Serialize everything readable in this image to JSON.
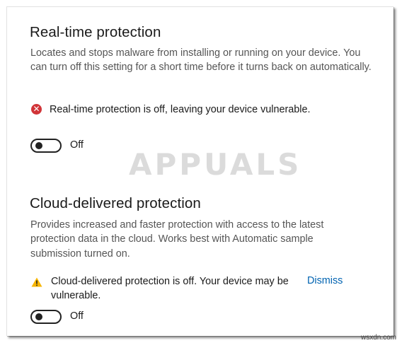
{
  "realtime": {
    "title": "Real-time protection",
    "description": "Locates and stops malware from installing or running on your device. You can turn off this setting for a short time before it turns back on automatically.",
    "status_text": "Real-time protection is off, leaving your device vulnerable.",
    "status_icon": "error-icon",
    "toggle_state": "Off"
  },
  "cloud": {
    "title": "Cloud-delivered protection",
    "description": "Provides increased and faster protection with access to the latest protection data in the cloud.  Works best with Automatic sample submission turned on.",
    "status_text": "Cloud-delivered protection is off. Your device may be vulnerable.",
    "status_icon": "warning-icon",
    "dismiss_label": "Dismiss",
    "toggle_state": "Off"
  },
  "watermark": {
    "text": "APPUALS"
  },
  "site_mark": "wsxdn.com",
  "colors": {
    "error": "#d13438",
    "warning": "#f7b500",
    "link": "#0063b1"
  }
}
